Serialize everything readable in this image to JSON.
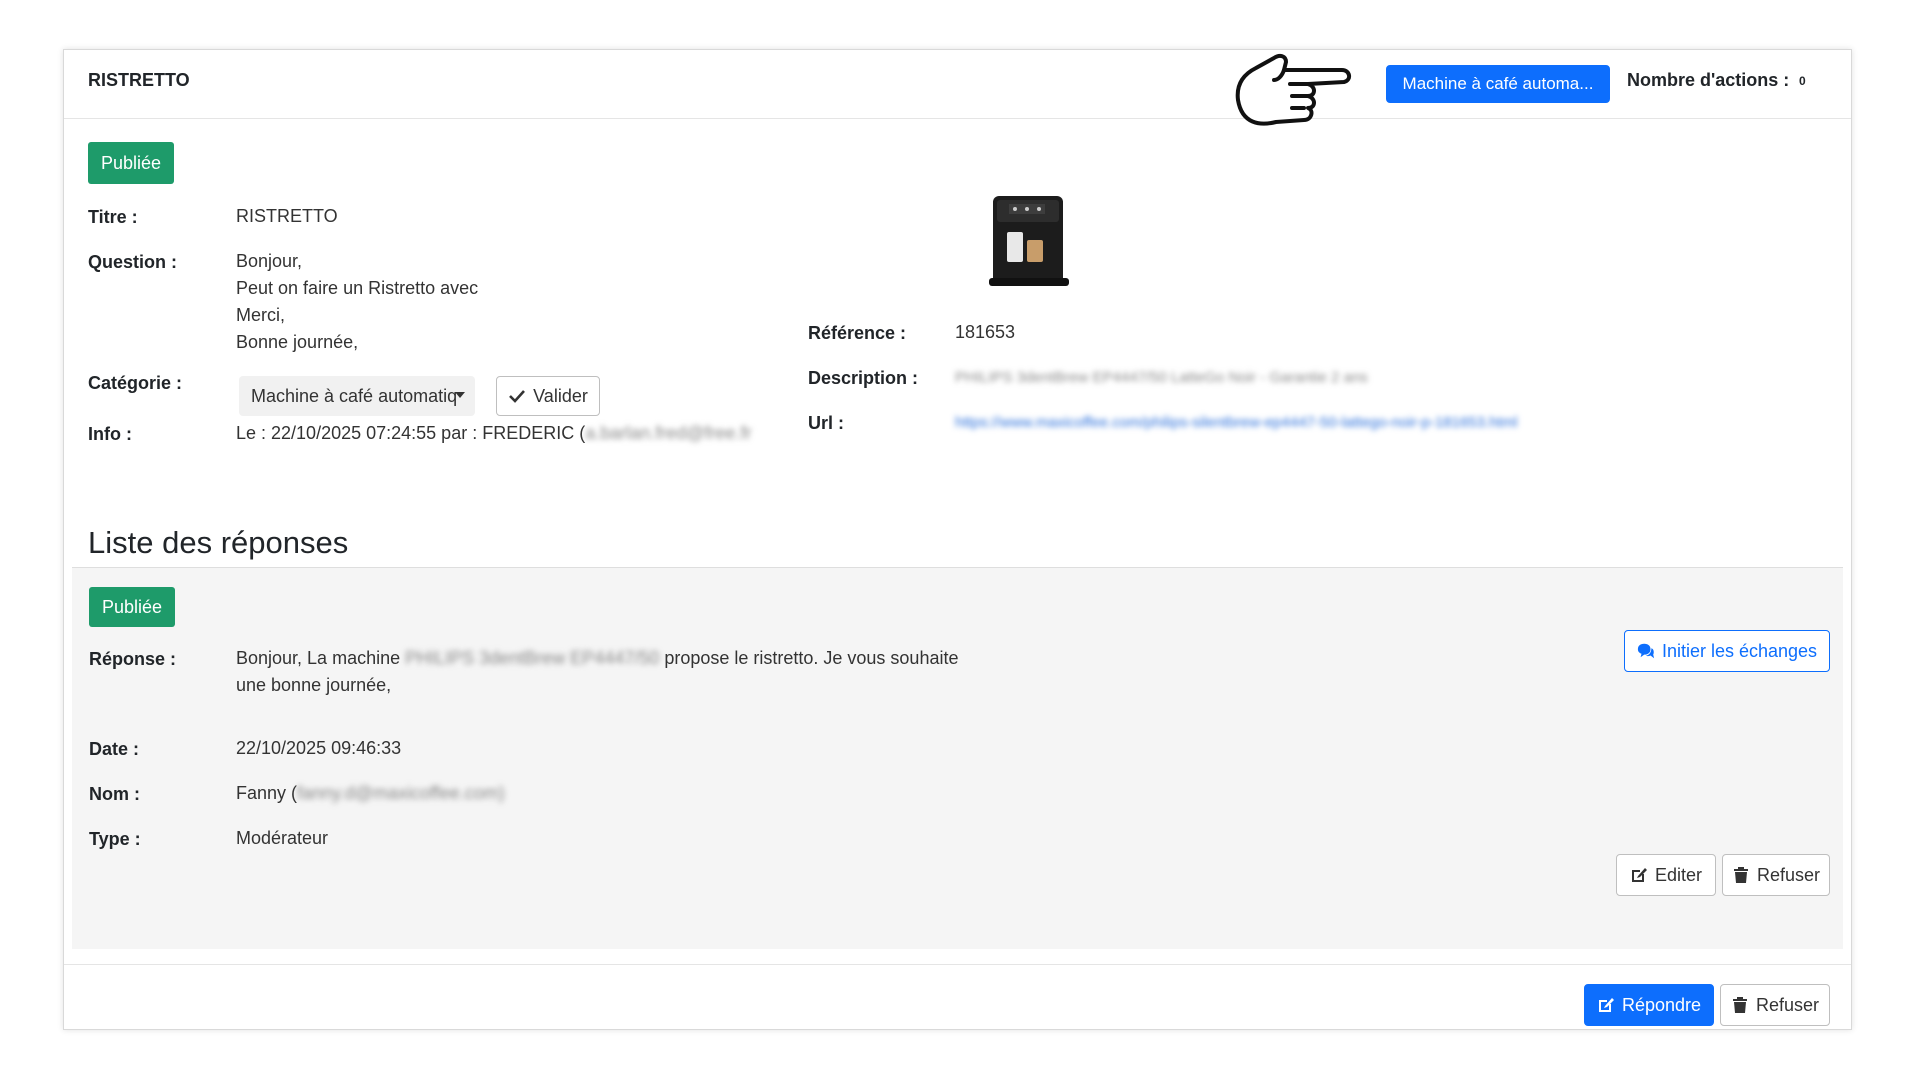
{
  "header": {
    "title": "RISTRETTO",
    "category_button": "Machine à café automa...",
    "actions_label": "Nombre d'actions :",
    "actions_count": "0"
  },
  "question": {
    "status_badge": "Publiée",
    "title_label": "Titre :",
    "title_value": "RISTRETTO",
    "question_label": "Question :",
    "question_lines": [
      "Bonjour,",
      "Peut on faire un Ristretto avec",
      "Merci,",
      "Bonne journée,"
    ],
    "category_label": "Catégorie :",
    "category_select": "Machine à café automatiq",
    "validate_button": "Valider",
    "info_label": "Info :",
    "info_value": "Le : 22/10/2025 07:24:55 par : FREDERIC (",
    "info_email_blurred": "a.barlan.fred@free.fr"
  },
  "product": {
    "reference_label": "Référence :",
    "reference_value": "181653",
    "description_label": "Description :",
    "description_blurred": "PHILIPS 3dentBrew EP4447/50 LatteGo Noir - Garantie 2 ans",
    "url_label": "Url :",
    "url_blurred": "https://www.maxicoffee.com/philips-silentbrew-ep4447-50-lattego-noir-p-181653.html"
  },
  "answers": {
    "section_title": "Liste des réponses",
    "status_badge": "Publiée",
    "response_label": "Réponse :",
    "response_prefix": "Bonjour, La machine",
    "response_model_blurred": "PHILIPS 3dentBrew EP4447/50",
    "response_suffix": "propose le ristretto. Je vous souhaite",
    "response_line2": "une bonne journée,",
    "date_label": "Date :",
    "date_value": "22/10/2025 09:46:33",
    "name_label": "Nom :",
    "name_value": "Fanny (",
    "name_email_blurred": "fanny.d@maxicoffee.com)",
    "type_label": "Type :",
    "type_value": "Modérateur",
    "exchange_button": "Initier les échanges",
    "edit_button": "Editer",
    "refuse_button": "Refuser"
  },
  "footer": {
    "reply_button": "Répondre",
    "refuse_button": "Refuser"
  },
  "colors": {
    "primary": "#0d6efd",
    "success_badge": "#1e9b6a",
    "answer_background": "#f5f5f5"
  }
}
